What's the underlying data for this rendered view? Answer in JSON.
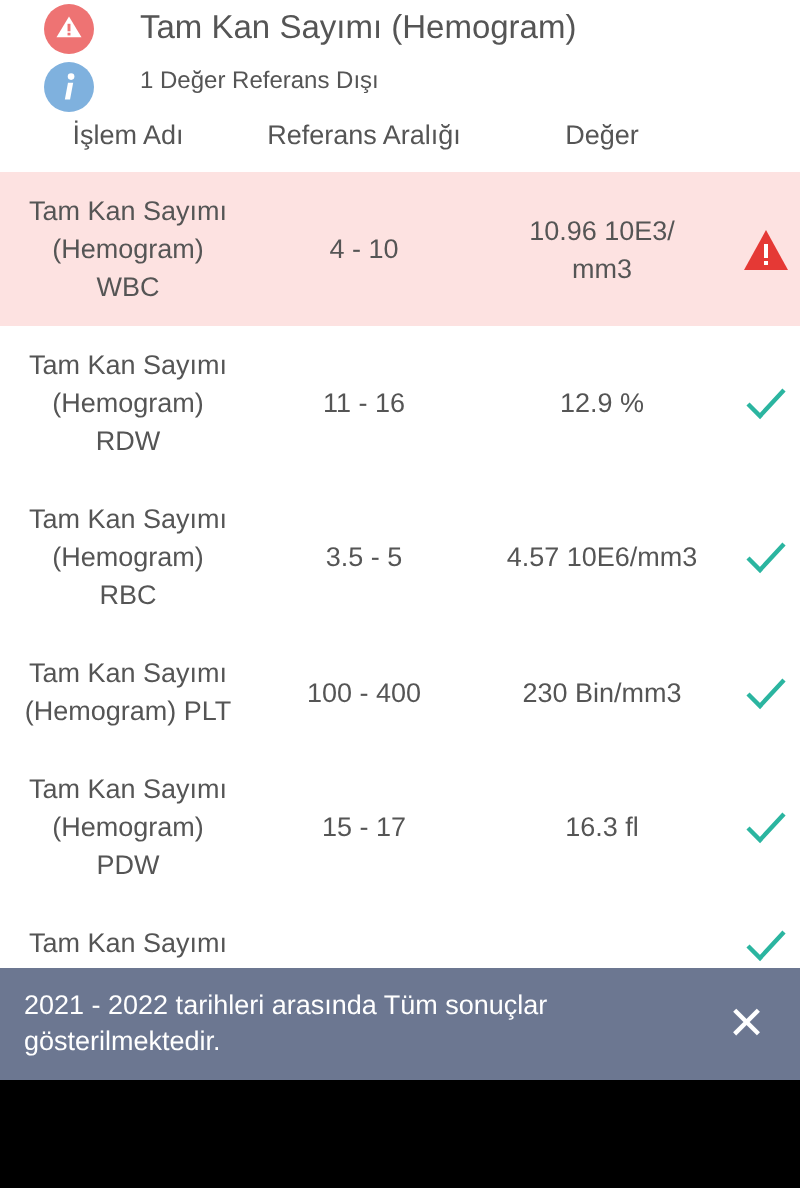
{
  "header": {
    "title": "Tam Kan Sayımı (Hemogram)",
    "subtitle": "1 Değer Referans Dışı"
  },
  "columns": [
    "İşlem Adı",
    "Referans Aralığı",
    "Değer"
  ],
  "rows": [
    {
      "name": "Tam Kan Sayımı (Hemogram) WBC",
      "range": "4 - 10",
      "value": "10.96 10E3/ mm3",
      "flagged": true
    },
    {
      "name": "Tam Kan Sayımı (Hemogram) RDW",
      "range": "11 - 16",
      "value": "12.9 %",
      "flagged": false
    },
    {
      "name": "Tam Kan Sayımı (Hemogram) RBC",
      "range": "3.5 - 5",
      "value": "4.57 10E6/mm3",
      "flagged": false
    },
    {
      "name": "Tam Kan Sayımı (Hemogram) PLT",
      "range": "100 - 400",
      "value": "230 Bin/mm3",
      "flagged": false
    },
    {
      "name": "Tam Kan Sayımı (Hemogram) PDW",
      "range": "15 - 17",
      "value": "16.3 fl",
      "flagged": false
    },
    {
      "name": "Tam Kan Sayımı",
      "flagged": false
    }
  ],
  "snackbar": {
    "message": "2021 - 2022 tarihleri arasında Tüm sonuçlar gösterilmektedir.",
    "close": "×"
  }
}
